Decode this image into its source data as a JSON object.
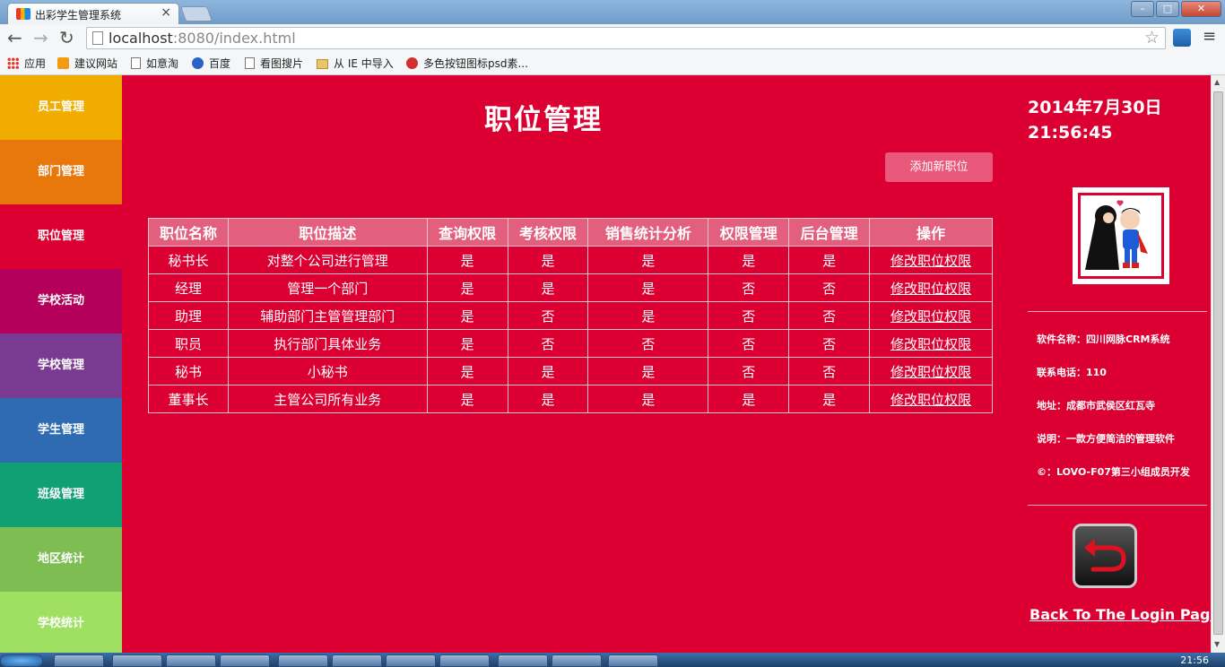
{
  "browser": {
    "tab_title": "出彩学生管理系统",
    "url_host": "localhost",
    "url_rest": ":8080/index.html",
    "bookmarks": [
      "应用",
      "建议网站",
      "如意淘",
      "百度",
      "看图搜片",
      "从 IE 中导入",
      "多色按钮图标psd素..."
    ]
  },
  "sidebar": {
    "items": [
      {
        "label": "员工管理",
        "color": "#f0ad00"
      },
      {
        "label": "部门管理",
        "color": "#e8770c"
      },
      {
        "label": "职位管理",
        "color": "#dc0032"
      },
      {
        "label": "学校活动",
        "color": "#b4005a"
      },
      {
        "label": "学校管理",
        "color": "#7b3a91"
      },
      {
        "label": "学生管理",
        "color": "#2f6bb3"
      },
      {
        "label": "班级管理",
        "color": "#0fa073"
      },
      {
        "label": "地区统计",
        "color": "#7dbd52"
      },
      {
        "label": "学校统计",
        "color": "#9fe063"
      }
    ]
  },
  "main": {
    "title": "职位管理",
    "add_button": "添加新职位",
    "table": {
      "headers": [
        "职位名称",
        "职位描述",
        "查询权限",
        "考核权限",
        "销售统计分析",
        "权限管理",
        "后台管理",
        "操作"
      ],
      "rows": [
        [
          "秘书长",
          "对整个公司进行管理",
          "是",
          "是",
          "是",
          "是",
          "是",
          "修改职位权限"
        ],
        [
          "经理",
          "管理一个部门",
          "是",
          "是",
          "是",
          "否",
          "否",
          "修改职位权限"
        ],
        [
          "助理",
          "辅助部门主管管理部门",
          "是",
          "否",
          "是",
          "否",
          "否",
          "修改职位权限"
        ],
        [
          "职员",
          "执行部门具体业务",
          "是",
          "否",
          "否",
          "否",
          "否",
          "修改职位权限"
        ],
        [
          "秘书",
          "小秘书",
          "是",
          "是",
          "是",
          "否",
          "否",
          "修改职位权限"
        ],
        [
          "董事长",
          "主管公司所有业务",
          "是",
          "是",
          "是",
          "是",
          "是",
          "修改职位权限"
        ]
      ]
    }
  },
  "right": {
    "date": "2014年7月30日",
    "time": "21:56:45",
    "info": [
      "软件名称：四川网脉CRM系统",
      "联系电话：110",
      "地址：成都市武侯区红瓦寺",
      "说明：一款方便简洁的管理软件",
      "©：LOVO-F07第三小组成员开发"
    ],
    "back_link": "Back To The Login Page"
  },
  "taskbar": {
    "clock": "21:56"
  }
}
